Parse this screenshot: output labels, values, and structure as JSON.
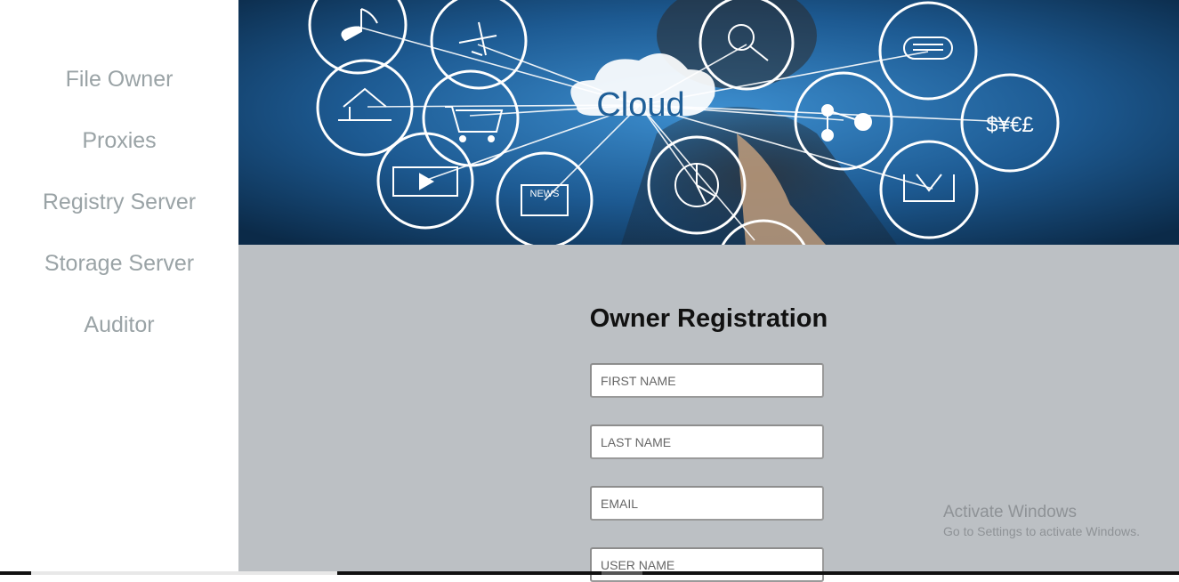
{
  "sidebar": {
    "items": [
      {
        "label": "File Owner"
      },
      {
        "label": "Proxies"
      },
      {
        "label": "Registry Server"
      },
      {
        "label": "Storage Server"
      },
      {
        "label": "Auditor"
      }
    ]
  },
  "banner": {
    "cloud_text": "Cloud",
    "news_text": "NEWS",
    "currency_text": "$¥€£",
    "icons": [
      "music-note-icon",
      "airplane-icon",
      "search-icon",
      "chat-bubble-icon",
      "upload-icon",
      "shopping-cart-icon",
      "network-icon",
      "currency-icon",
      "video-play-icon",
      "news-icon",
      "pie-chart-icon",
      "download-icon"
    ]
  },
  "form": {
    "title": "Owner Registration",
    "first_name_placeholder": "FIRST NAME",
    "last_name_placeholder": "LAST NAME",
    "email_placeholder": "EMAIL",
    "username_placeholder": "USER NAME"
  },
  "watermark": {
    "title": "Activate Windows",
    "subtitle": "Go to Settings to activate Windows."
  },
  "colors": {
    "nav_text": "#9aa3a6",
    "form_bg": "#bcc0c4",
    "banner_bg": "#1e5f96"
  }
}
